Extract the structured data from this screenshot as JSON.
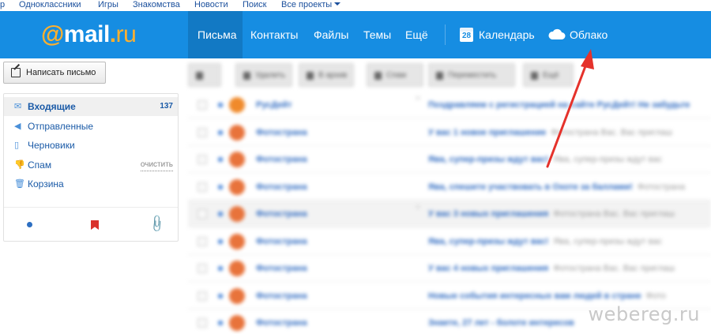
{
  "portal": {
    "items": [
      "р",
      "Одноклассники",
      "Игры",
      "Знакомства",
      "Новости",
      "Поиск",
      "Все проекты"
    ]
  },
  "header": {
    "logo": {
      "at": "@",
      "name": "mail",
      "dot": ".",
      "tld": "ru"
    },
    "nav": [
      "Письма",
      "Контакты",
      "Файлы",
      "Темы",
      "Ещё"
    ],
    "calendar_label": "Календарь",
    "calendar_day": "28",
    "cloud_label": "Облако",
    "colors": {
      "bar": "#168de2",
      "active": "#1279c4",
      "logo_accent": "#ffb02e"
    }
  },
  "sidebar": {
    "compose_label": "Написать письмо",
    "folders": [
      {
        "label": "Входящие",
        "icon": "envelope-icon",
        "count": "137"
      },
      {
        "label": "Отправленные",
        "icon": "reply-arrow-icon"
      },
      {
        "label": "Черновики",
        "icon": "draft-icon"
      },
      {
        "label": "Спам",
        "icon": "thumb-down-icon",
        "action": "очистить"
      },
      {
        "label": "Корзина",
        "icon": "trash-icon"
      }
    ],
    "bottom_icons": [
      "unread-dot-icon",
      "flag-icon",
      "attachment-icon"
    ]
  },
  "mail": {
    "toolbar": [
      "Удалить",
      "В архив",
      "Спам",
      "Переместить",
      "Ещё"
    ],
    "rows": [
      {
        "sender": "РусДейт",
        "subject": "Поздравляем с регистрацией на сайте РусДейт! Не забудьте"
      },
      {
        "sender": "Фотострана",
        "subject": "У вас 1 новое приглашение",
        "snippet": "Фотострана Вас. Вас приглаш"
      },
      {
        "sender": "Фотострана",
        "subject": "Ява, супер-призы ждут вас!",
        "snippet": "Ява, супер-призы ждут вас"
      },
      {
        "sender": "Фотострана",
        "subject": "Ява, спешите участвовать в Охоте за баллами!",
        "snippet": "Фотострана"
      },
      {
        "sender": "Фотострана",
        "subject": "У вас 3 новых приглашения",
        "snippet": "Фотострана Вас. Вас приглаш"
      },
      {
        "sender": "Фотострана",
        "subject": "Ява, супер-призы ждут вас!",
        "snippet": "Ява, супер-призы ждут вас"
      },
      {
        "sender": "Фотострана",
        "subject": "У вас 4 новых приглашения",
        "snippet": "Фотострана Вас. Вас приглаш"
      },
      {
        "sender": "Фотострана",
        "subject": "Новые события интересных вам людей в стране",
        "snippet": "Фото"
      },
      {
        "sender": "Фотострана",
        "subject": "Знаете, 27 лет - болоте интересов",
        "snippet": ""
      }
    ]
  },
  "watermark": "webereg.ru"
}
